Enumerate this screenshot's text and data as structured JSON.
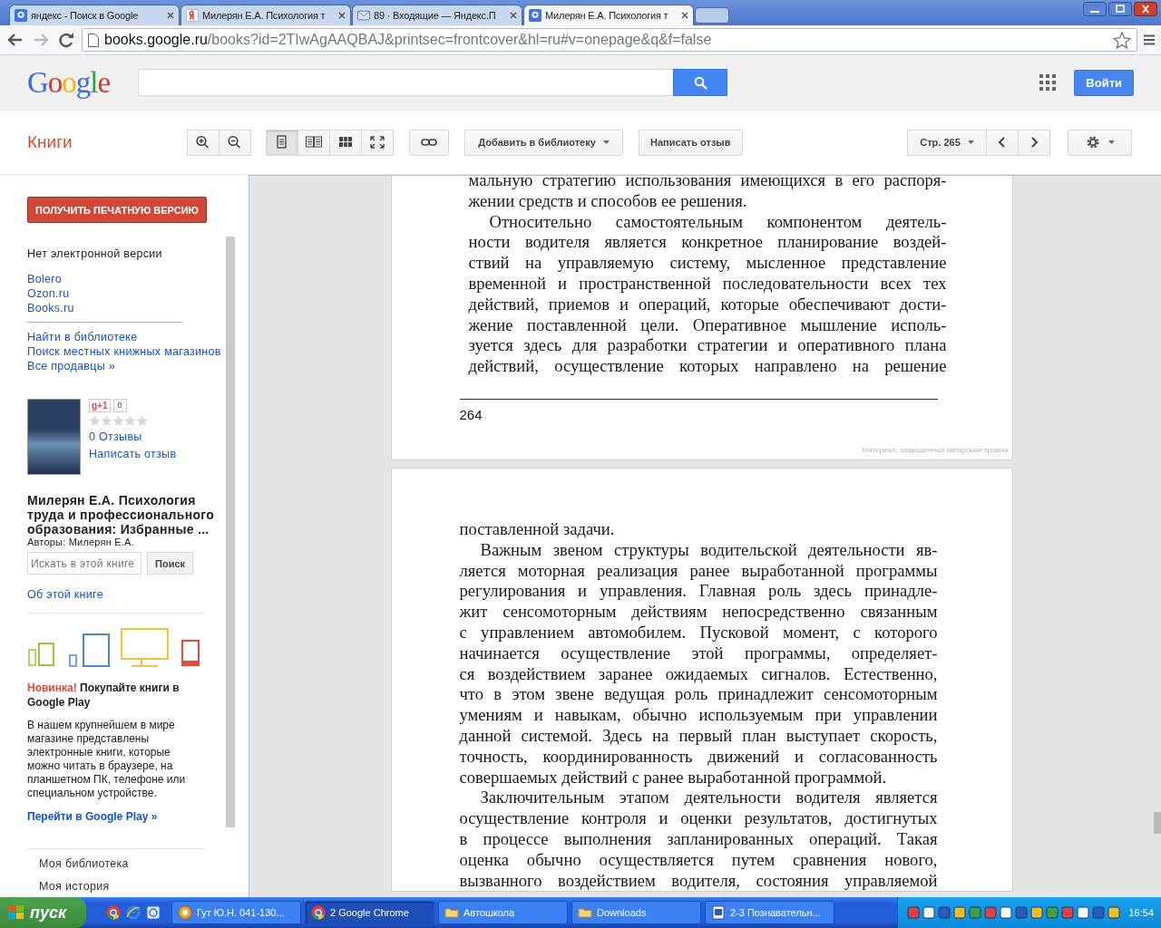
{
  "browser": {
    "tabs": [
      {
        "title": "яндекс - Поиск в Google",
        "kind": "google",
        "selected": false
      },
      {
        "title": "Милерян Е.А. Психология т",
        "kind": "yandex",
        "selected": false
      },
      {
        "title": "89 · Входящие — Яндекс.П",
        "kind": "mail",
        "selected": false
      },
      {
        "title": "Милерян Е.А. Психология т",
        "kind": "google",
        "selected": true
      }
    ],
    "address": {
      "host": "books.google.ru",
      "path": "/books?id=2TIwAgAAQBAJ&printsec=frontcover&hl=ru#v=onepage&q&f=false"
    }
  },
  "header": {
    "logo": "Google",
    "signin": "Войти"
  },
  "toolbar": {
    "section": "Книги",
    "view_modes": [
      {
        "kind": "single",
        "selected": true
      },
      {
        "kind": "double",
        "selected": false
      },
      {
        "kind": "grid",
        "selected": false
      },
      {
        "kind": "fullscreen",
        "selected": false
      }
    ],
    "add_library": "Добавить в библиотеку",
    "review": "Написать отзыв",
    "page": "Стр. 265"
  },
  "sidebar": {
    "print_button": "ПОЛУЧИТЬ ПЕЧАТНУЮ ВЕРСИЮ",
    "no_ebook": "Нет электронной версии",
    "sellers": [
      "Bolero",
      "Ozon.ru",
      "Books.ru"
    ],
    "more_links": [
      "Найти в библиотеке",
      "Поиск местных книжных магазинов",
      "Все продавцы »"
    ],
    "plus_one": "g+1",
    "plus_count": "0",
    "stars": 0,
    "reviews": "0 Отзывы",
    "write_review": "Написать отзыв",
    "book_title": "Милерян Е.А. Психология труда и профессионального образования: Избранные ...",
    "authors": "Авторы: Милерян Е.А.",
    "search": {
      "placeholder": "Искать в этой книге",
      "button": "Поиск"
    },
    "about": "Об этой книге",
    "promo": {
      "badge": "Новинка!",
      "title": "Покупайте книги в Google Play",
      "text": "В нашем крупнейшем в мире магазине представлены электронные книги, которые можно читать в браузере, на планшетном ПК, телефоне или специальном устройстве.",
      "link": "Перейти в Google Play »"
    },
    "nav": [
      "Моя библиотека",
      "Моя история"
    ]
  },
  "viewer": {
    "pages": [
      {
        "lines": [
          {
            "kind": "line",
            "text": "мальную стратегию использования имеющихся в его распоря-"
          },
          {
            "kind": "last",
            "text": "жении средств и способов ее решения."
          },
          {
            "kind": "indent",
            "text": "Относительно самостоятельным компонентом деятель-"
          },
          {
            "kind": "line",
            "text": "ности водителя является конкретное планирование воздей-"
          },
          {
            "kind": "line",
            "text": "ствий на управляемую систему, мысленное представление"
          },
          {
            "kind": "line",
            "text": "временной и пространственной последовательности всех тех"
          },
          {
            "kind": "line",
            "text": "действий, приемов и операций, которые обеспечивают дости-"
          },
          {
            "kind": "line",
            "text": "жение поставленной цели. Оперативное мышление исполь-"
          },
          {
            "kind": "line",
            "text": "зуется здесь для разработки стратегии и оперативного плана"
          },
          {
            "kind": "line",
            "text": "действий, осуществление которых направлено на решение"
          }
        ],
        "number": "264",
        "copyright": "Материал, защищенный авторским правом"
      },
      {
        "lines": [
          {
            "kind": "last",
            "text": "поставленной задачи."
          },
          {
            "kind": "indent",
            "text": "Важным звеном структуры водительской деятельности яв-"
          },
          {
            "kind": "line",
            "text": "ляется моторная реализация ранее выработанной программы"
          },
          {
            "kind": "line",
            "text": "регулирования и управления. Главная роль здесь принадле-"
          },
          {
            "kind": "line",
            "text": "жит сенсомоторным действиям непосредственно связанным"
          },
          {
            "kind": "line",
            "text": "с управлением автомобилем. Пусковой момент, с которого"
          },
          {
            "kind": "line",
            "text": "начинается осуществление этой программы, определяет-"
          },
          {
            "kind": "line",
            "text": "ся воздействием заранее ожидаемых сигналов. Естественно,"
          },
          {
            "kind": "line",
            "text": "что в этом звене ведущая роль принадлежит сенсомоторным"
          },
          {
            "kind": "line",
            "text": "умениям и навыкам, обычно используемым при управлении"
          },
          {
            "kind": "line",
            "text": "данной системой. Здесь на первый план выступает скорость,"
          },
          {
            "kind": "line",
            "text": "точность, координированность движений и согласованность"
          },
          {
            "kind": "last",
            "text": "совершаемых действий с ранее выработанной программой."
          },
          {
            "kind": "indent",
            "text": "Заключительным этапом деятельности водителя является"
          },
          {
            "kind": "line",
            "text": "осуществление контроля и оценки результатов, достигнутых"
          },
          {
            "kind": "line",
            "text": "в процессе выполнения запланированных операций. Такая"
          },
          {
            "kind": "line",
            "text": "оценка обычно осуществляется путем сравнения нового,"
          },
          {
            "kind": "line",
            "text": "вызванного воздействием водителя, состояния управляемой"
          }
        ]
      }
    ]
  },
  "taskbar": {
    "start": "пуск",
    "tasks": [
      {
        "label": "Гут Ю.Н. 041-130...",
        "kind": "app",
        "selected": false
      },
      {
        "label": "2 Google Chrome",
        "kind": "chrome",
        "selected": true
      },
      {
        "label": "Автошкола",
        "kind": "folder",
        "selected": false
      },
      {
        "label": "Downloads",
        "kind": "folder",
        "selected": false
      },
      {
        "label": "2-3 Познавательн...",
        "kind": "doc",
        "selected": false
      }
    ],
    "clock": "16:54"
  }
}
